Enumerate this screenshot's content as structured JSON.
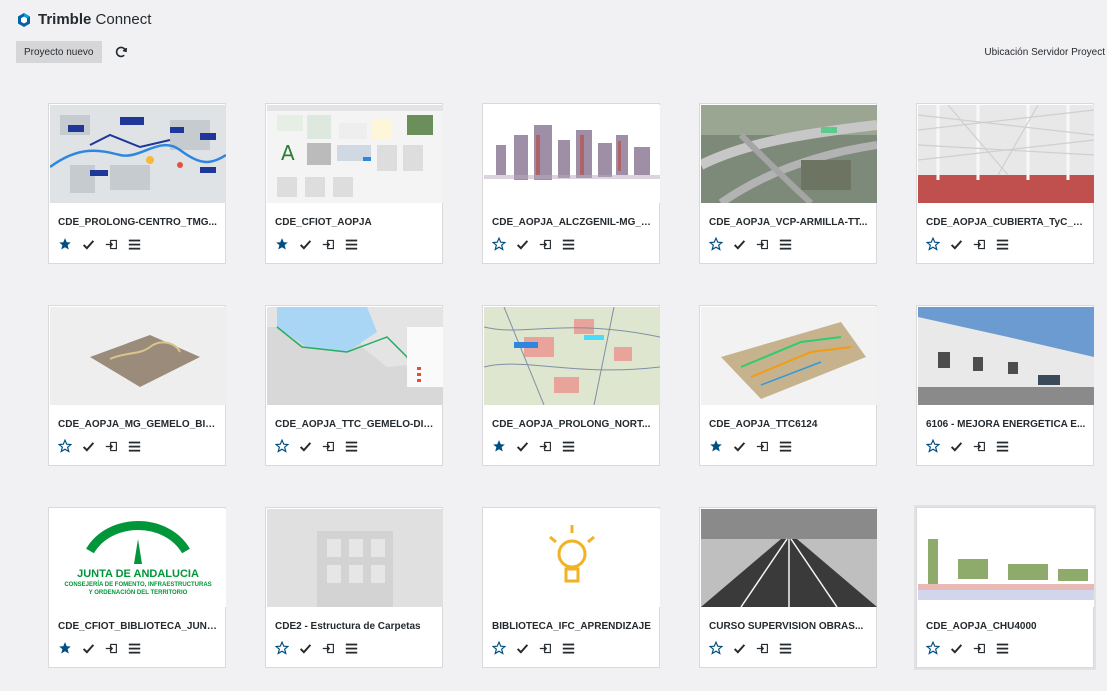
{
  "app": {
    "brand_bold": "Trimble",
    "brand_light": "Connect",
    "accent": "#0063a3",
    "star_color": "#004f83"
  },
  "toolbar": {
    "new_project_label": "Proyecto nuevo",
    "server_label": "Ubicación Servidor Proyect"
  },
  "projects": [
    {
      "title": "CDE_PROLONG-CENTRO_TMG...",
      "starred": true,
      "thumb": "map-blue-route"
    },
    {
      "title": "CDE_CFIOT_AOPJA",
      "starred": true,
      "thumb": "screenshot-doc"
    },
    {
      "title": "CDE_AOPJA_ALCZGENIL-MG_T...",
      "starred": false,
      "thumb": "pointcloud-city"
    },
    {
      "title": "CDE_AOPJA_VCP-ARMILLA-TT...",
      "starred": false,
      "thumb": "aerial-highway"
    },
    {
      "title": "CDE_AOPJA_CUBIERTA_TyC_T...",
      "starred": false,
      "thumb": "steel-structure"
    },
    {
      "title": "CDE_AOPJA_MG_GEMELO_BIM...",
      "starred": false,
      "thumb": "terrain-model"
    },
    {
      "title": "CDE_AOPJA_TTC_GEMELO-DIG...",
      "starred": false,
      "thumb": "coast-map"
    },
    {
      "title": "CDE_AOPJA_PROLONG_NORT...",
      "starred": true,
      "thumb": "topo-map"
    },
    {
      "title": "CDE_AOPJA_TTC6124",
      "starred": true,
      "thumb": "3d-terrain"
    },
    {
      "title": "6106 - MEJORA ENERGÉTICA E...",
      "starred": false,
      "thumb": "houses-photo"
    },
    {
      "title": "CDE_CFIOT_BIBLIOTECA_JUNT...",
      "starred": true,
      "thumb": "junta-logo",
      "logo_lines": [
        "JUNTA DE ANDALUCIA",
        "CONSEJERÍA DE FOMENTO, INFRAESTRUCTURAS",
        "Y ORDENACIÓN DEL TERRITORIO"
      ]
    },
    {
      "title": "CDE2 - Estructura de Carpetas",
      "starred": false,
      "thumb": "placeholder-building"
    },
    {
      "title": "BIBLIOTECA_IFC_APRENDIZAJE",
      "starred": false,
      "thumb": "lightbulb"
    },
    {
      "title": "CURSO SUPERVISION OBRAS...",
      "starred": false,
      "thumb": "road-photo"
    },
    {
      "title": "CDE_AOPJA_CHU4000",
      "starred": false,
      "thumb": "pointcloud-field",
      "selected": true
    }
  ],
  "actions": {
    "star_icon": "star-icon",
    "check_icon": "checkmark-icon",
    "enter_icon": "enter-project-icon",
    "menu_icon": "menu-icon"
  }
}
